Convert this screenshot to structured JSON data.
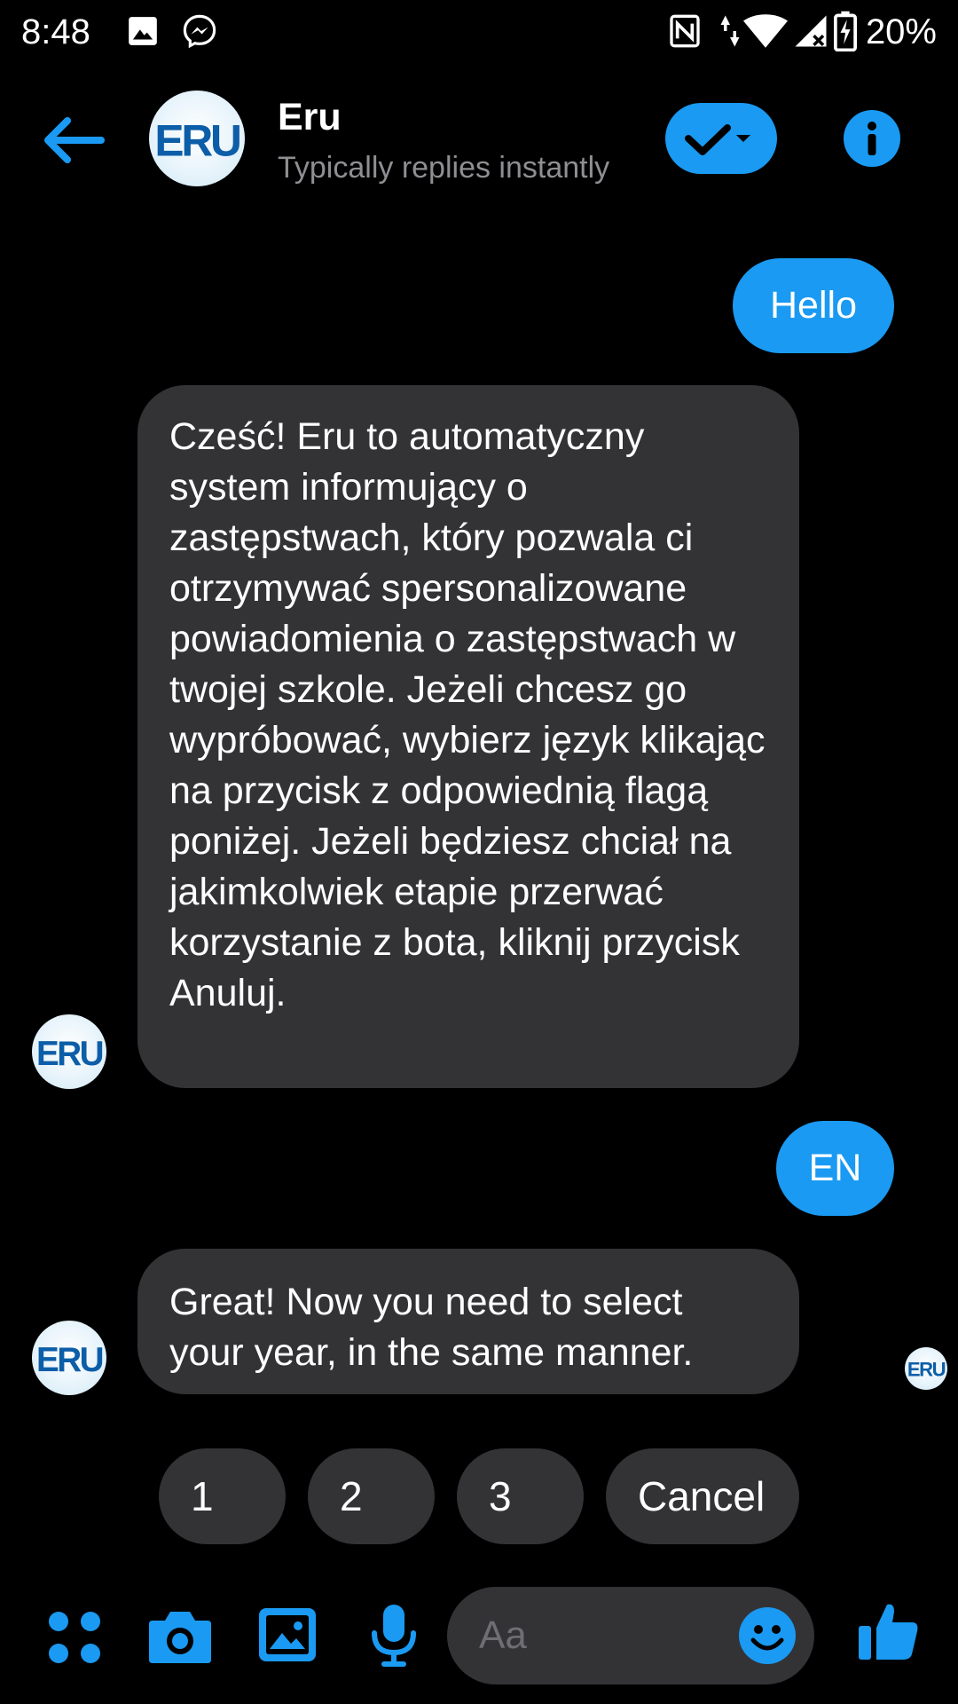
{
  "status_bar": {
    "time": "8:48",
    "battery": "20%",
    "icons": [
      "gallery-icon",
      "messenger-icon",
      "nfc-icon",
      "data-arrows-icon",
      "wifi-icon",
      "cell-signal-icon",
      "battery-charging-icon"
    ]
  },
  "header": {
    "contact_name": "Eru",
    "contact_status": "Typically replies instantly",
    "avatar_text": "ERU",
    "accent_color": "#1a9af2"
  },
  "messages": [
    {
      "from": "me",
      "text": "Hello"
    },
    {
      "from": "bot",
      "text": "Cześć! Eru to automatyczny system informujący o zastępstwach, który pozwala ci otrzymywać spersonalizowane powiadomienia o zastępstwach w twojej szkole. Jeżeli chcesz go wypróbować, wybierz język klikając na przycisk z odpowiednią flagą poniżej. Jeżeli będziesz chciał na jakimkolwiek etapie przerwać korzystanie z bota, kliknij przycisk Anuluj."
    },
    {
      "from": "me",
      "text": "EN"
    },
    {
      "from": "bot",
      "text": "Great! Now you need to select your year, in the same manner."
    }
  ],
  "quick_replies": [
    "1",
    "2",
    "3",
    "Cancel"
  ],
  "composer": {
    "placeholder": "Aa"
  },
  "colors": {
    "background": "#000000",
    "bubble_incoming": "#333336",
    "bubble_outgoing": "#1a9af2",
    "secondary_text": "#8e8e93"
  }
}
